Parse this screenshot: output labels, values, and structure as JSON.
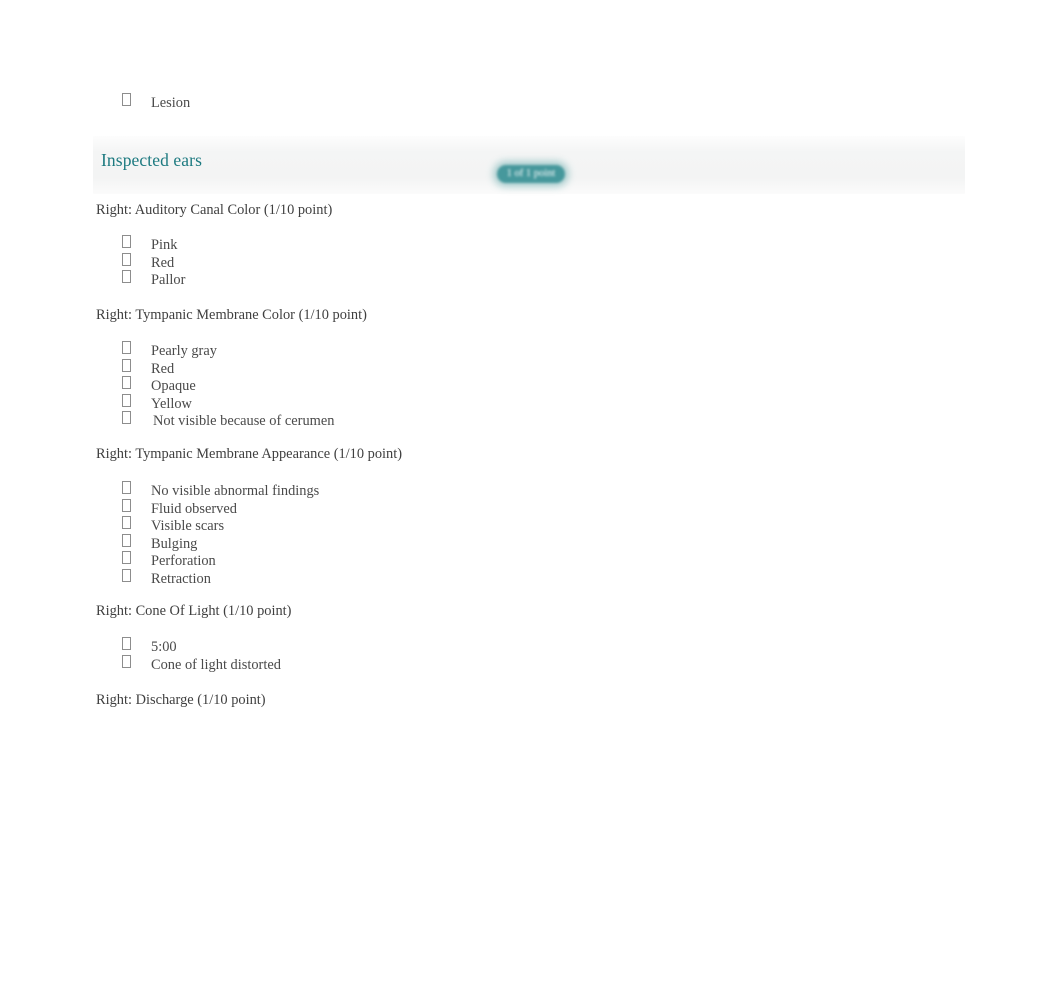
{
  "orphan_item": {
    "bullet": "empty-checkbox-glyph",
    "label": "Lesion"
  },
  "section": {
    "title": "Inspected ears",
    "score_badge": "1 of 1 point",
    "badge_color": "#46989c",
    "title_color": "#1d7a80",
    "band_color": "#f4f5f5"
  },
  "questions": [
    {
      "label": "Right: Auditory Canal Color (1/10 point)",
      "options": [
        {
          "label": "Pink",
          "wide": false
        },
        {
          "label": "Red",
          "wide": false
        },
        {
          "label": "Pallor",
          "wide": false
        }
      ]
    },
    {
      "label": "Right: Tympanic Membrane Color (1/10 point)",
      "options": [
        {
          "label": "Pearly gray",
          "wide": false
        },
        {
          "label": "Red",
          "wide": false
        },
        {
          "label": "Opaque",
          "wide": false
        },
        {
          "label": "Yellow",
          "wide": false
        },
        {
          "label": "Not visible because of cerumen",
          "wide": true
        }
      ]
    },
    {
      "label": "Right: Tympanic Membrane Appearance (1/10 point)",
      "options": [
        {
          "label": "No visible abnormal findings",
          "wide": false
        },
        {
          "label": "Fluid observed",
          "wide": false
        },
        {
          "label": "Visible scars",
          "wide": false
        },
        {
          "label": "Bulging",
          "wide": false
        },
        {
          "label": "Perforation",
          "wide": false
        },
        {
          "label": "Retraction",
          "wide": false
        }
      ]
    },
    {
      "label": "Right: Cone Of Light (1/10 point)",
      "options": [
        {
          "label": "5:00",
          "wide": false
        },
        {
          "label": "Cone of light distorted",
          "wide": false
        }
      ]
    },
    {
      "label": "Right: Discharge (1/10 point)",
      "options": []
    }
  ]
}
